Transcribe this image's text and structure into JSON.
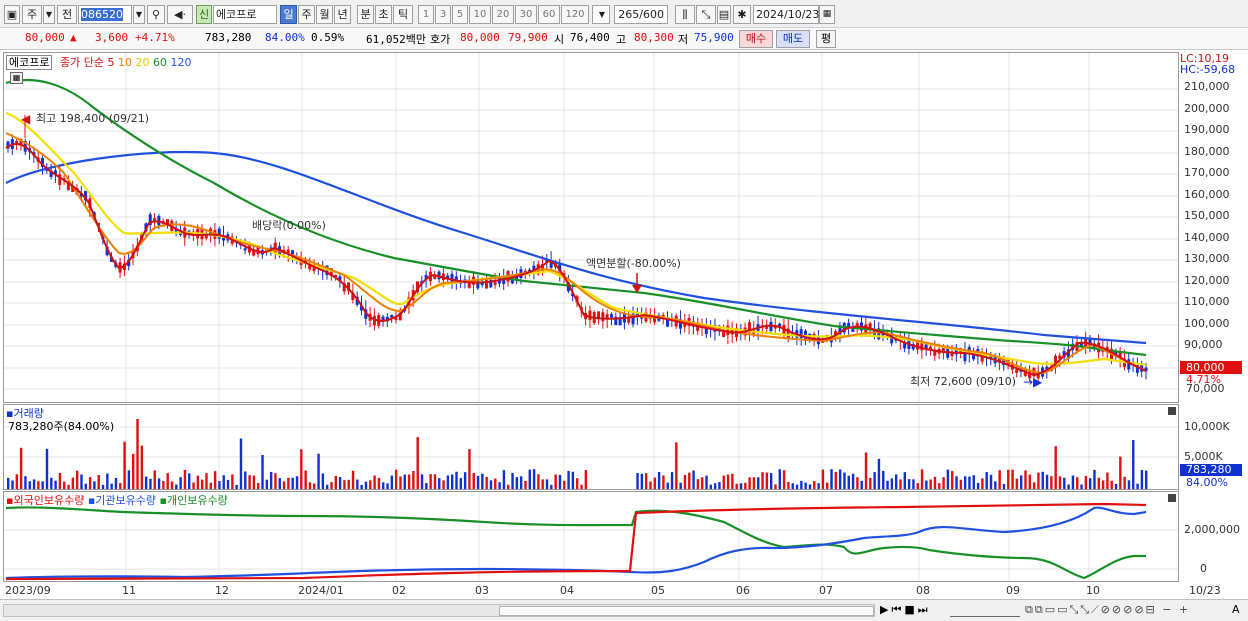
{
  "toolbar": {
    "period_label": "주",
    "prev_label": "전",
    "code": "086520",
    "market_badge": "신",
    "stock_name": "에코프로",
    "tabs": [
      "일",
      "주",
      "월",
      "년",
      "분",
      "초",
      "틱"
    ],
    "minute_options": [
      "1",
      "3",
      "5",
      "10",
      "20",
      "30",
      "60",
      "120"
    ],
    "count": "265/600",
    "date": "2024/10/23"
  },
  "quote": {
    "price": "80,000",
    "change_arrow": "▲",
    "change": "3,600",
    "change_pct": "+4.71%",
    "volume": "783,280",
    "volume_ratio": "84.00%",
    "turnover": "0.59%",
    "amount": "61,052백만",
    "bid_label": "호가",
    "ask_price": "80,000",
    "bid_price": "79,900",
    "open_label": "시",
    "open": "76,400",
    "high_label": "고",
    "high": "80,300",
    "low_label": "저",
    "low": "75,900",
    "buy_label": "매수",
    "sell_label": "매도",
    "avg_label": "평"
  },
  "price_pane": {
    "legend_name": "에코프로",
    "legend_ma": "종가 단순",
    "ma_periods": [
      "5",
      "10",
      "20",
      "60",
      "120"
    ],
    "ma_colors": [
      "#d01010",
      "#f08000",
      "#f0e000",
      "#189028",
      "#2050e0"
    ],
    "lc": "LC:10,19",
    "hc": "HC:-59,68",
    "high_annot": "최고 198,400 (09/21)",
    "low_annot": "최저 72,600 (09/10)",
    "dividend_annot": "배당락(0.00%)",
    "split_annot": "액면분할(-80.00%)",
    "current_price": "80,000",
    "current_pct": "4.71%",
    "y_ticks": [
      "210,000",
      "200,000",
      "190,000",
      "180,000",
      "170,000",
      "160,000",
      "150,000",
      "140,000",
      "130,000",
      "120,000",
      "110,000",
      "100,000",
      "90,000",
      "70,000"
    ]
  },
  "volume_pane": {
    "title": "거래량",
    "value": "783,280주(84.00%)",
    "y_ticks": [
      "10,000K",
      "5,000K"
    ],
    "current": "783,280",
    "current_pct": "84.00%"
  },
  "holding_pane": {
    "legend": [
      "외국인보유수량",
      "기관보유수량",
      "개인보유수량"
    ],
    "colors": [
      "#e01010",
      "#2050e0",
      "#189028"
    ],
    "y_ticks": [
      "2,000,000",
      "0"
    ]
  },
  "x_axis": {
    "labels": [
      "2023/09",
      "11",
      "12",
      "2024/01",
      "02",
      "03",
      "04",
      "05",
      "06",
      "07",
      "08",
      "09",
      "10",
      "10/23"
    ]
  },
  "chart_data": {
    "type": "line",
    "title": "에코프로",
    "series": [
      {
        "name": "120",
        "values": [
          [
            0,
            170000
          ],
          [
            20,
            174000
          ],
          [
            40,
            178000
          ],
          [
            55,
            180000
          ],
          [
            70,
            180000
          ],
          [
            85,
            178000
          ],
          [
            100,
            174000
          ],
          [
            120,
            168000
          ],
          [
            140,
            161000
          ],
          [
            160,
            153000
          ],
          [
            180,
            145000
          ],
          [
            200,
            138000
          ],
          [
            220,
            132000
          ],
          [
            240,
            126000
          ],
          [
            260,
            121000
          ],
          [
            280,
            117000
          ],
          [
            300,
            113000
          ],
          [
            320,
            109000
          ],
          [
            340,
            106000
          ],
          [
            360,
            103000
          ],
          [
            380,
            100000
          ],
          [
            400,
            98000
          ],
          [
            420,
            96000
          ],
          [
            440,
            94000
          ],
          [
            460,
            93000
          ],
          [
            480,
            91000
          ],
          [
            500,
            89000
          ],
          [
            520,
            88000
          ],
          [
            535,
            87000
          ]
        ]
      },
      {
        "name": "60",
        "values": [
          [
            0,
            207000
          ],
          [
            20,
            204000
          ],
          [
            40,
            196000
          ],
          [
            60,
            186000
          ],
          [
            80,
            175000
          ],
          [
            100,
            165000
          ],
          [
            120,
            156000
          ],
          [
            140,
            148000
          ],
          [
            160,
            141000
          ],
          [
            180,
            135000
          ],
          [
            200,
            130000
          ],
          [
            220,
            126000
          ],
          [
            240,
            122000
          ],
          [
            260,
            119000
          ],
          [
            280,
            117000
          ],
          [
            300,
            113000
          ],
          [
            320,
            109000
          ],
          [
            340,
            104000
          ],
          [
            360,
            100000
          ],
          [
            380,
            98000
          ],
          [
            400,
            96000
          ],
          [
            420,
            94000
          ],
          [
            440,
            93000
          ],
          [
            460,
            91000
          ],
          [
            480,
            90000
          ],
          [
            500,
            91000
          ],
          [
            520,
            89000
          ],
          [
            535,
            86000
          ]
        ]
      }
    ],
    "y_range": [
      68000,
      215000
    ]
  }
}
